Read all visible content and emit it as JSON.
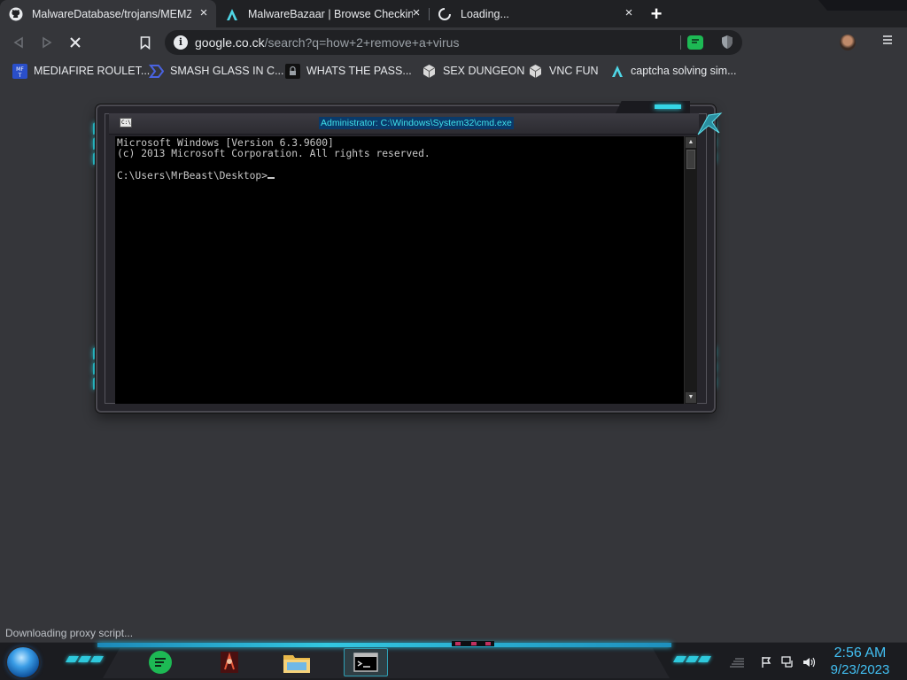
{
  "browser": {
    "tabs": [
      {
        "title": "MalwareDatabase/trojans/MEMZ.z",
        "icon": "github-icon",
        "close": "×"
      },
      {
        "title": "MalwareBazaar | Browse Checking",
        "icon": "malwarebazaar-icon",
        "close": "×"
      },
      {
        "title": "Loading...",
        "icon": "loading-spinner-icon",
        "close": "×"
      }
    ],
    "new_tab_label": "+",
    "address": {
      "host": "google.co.ck",
      "path": "/search?q=how+2+remove+a+virus"
    },
    "bookmarks": [
      {
        "label": "MEDIAFIRE ROULET...",
        "icon": "mediafire-icon"
      },
      {
        "label": "SMASH GLASS IN C...",
        "icon": "chevron-logo-icon"
      },
      {
        "label": "WHATS THE PASS...",
        "icon": "lock-icon"
      },
      {
        "label": "SEX DUNGEON",
        "icon": "cube-icon"
      },
      {
        "label": "VNC FUN",
        "icon": "cube-icon"
      },
      {
        "label": "captcha solving sim...",
        "icon": "malwarebazaar-icon"
      }
    ],
    "status_text": "Downloading proxy script..."
  },
  "cmd": {
    "title": "Administrator: C:\\Windows\\System32\\cmd.exe",
    "icon_text": "C:\\",
    "lines": {
      "line1": "Microsoft Windows [Version 6.3.9600]",
      "line2": "(c) 2013 Microsoft Corporation. All rights reserved.",
      "prompt": "C:\\Users\\MrBeast\\Desktop>"
    }
  },
  "taskbar": {
    "clock_time": "2:56 AM",
    "clock_date": "9/23/2023",
    "cmd_icon_text": "C:\\"
  },
  "colors": {
    "accent_cyan": "#2fd1df",
    "clock_blue": "#42bff2",
    "spotify_green": "#1db954"
  }
}
